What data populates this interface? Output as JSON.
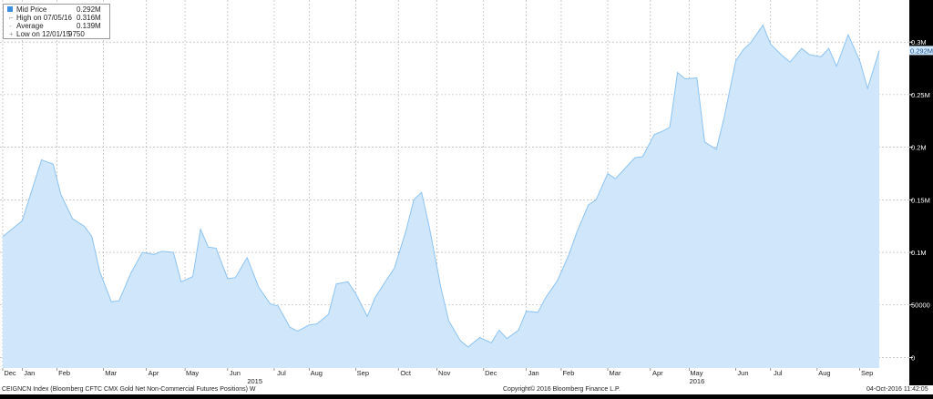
{
  "legend": {
    "items": [
      {
        "label": "Mid Price",
        "value": "0.292M"
      },
      {
        "label": "High on 07/05/16",
        "value": "0.316M"
      },
      {
        "label": "Average",
        "value": "0.139M"
      },
      {
        "label": "Low on 12/01/15",
        "value": "9750"
      }
    ]
  },
  "footer": {
    "ticker": "CEIGNCN Index (Bloomberg CFTC CMX Gold Net Non-Commercial Futures Positions)  W",
    "copyright": "Copyright© 2016 Bloomberg Finance L.P.",
    "timestamp": "04-Oct-2016 11:42:05"
  },
  "chart_data": {
    "type": "area",
    "title": "",
    "xlabel": "",
    "ylabel": "",
    "ylim": [
      -10000,
      340000
    ],
    "grid": true,
    "legend_position": "top-left",
    "colors": {
      "fill": "#cfe6fb",
      "line": "#8dc4f2",
      "background": "#ffffff",
      "grid": "#aaaaaa",
      "last_value_badge": "#cfe6fb"
    },
    "last_value_label": "0.292M",
    "y_ticks": [
      {
        "value": 300000,
        "label": "0.3M"
      },
      {
        "value": 250000,
        "label": "0.25M"
      },
      {
        "value": 200000,
        "label": "0.2M"
      },
      {
        "value": 150000,
        "label": "0.15M"
      },
      {
        "value": 100000,
        "label": "0.1M"
      },
      {
        "value": 50000,
        "label": "50000"
      },
      {
        "value": 0,
        "label": "0"
      }
    ],
    "x_months": [
      {
        "label": "Dec",
        "week": 0
      },
      {
        "label": "Jan",
        "week": 5
      },
      {
        "label": "Feb",
        "week": 14
      },
      {
        "label": "Mar",
        "week": 26
      },
      {
        "label": "Apr",
        "week": 37
      },
      {
        "label": "May",
        "week": 47
      },
      {
        "label": "Jun",
        "week": 58
      },
      {
        "label": "Jul",
        "week": 70
      },
      {
        "label": "Aug",
        "week": 79
      },
      {
        "label": "Sep",
        "week": 91
      },
      {
        "label": "Oct",
        "week": 102
      },
      {
        "label": "Nov",
        "week": 112
      },
      {
        "label": "Dec",
        "week": 124
      },
      {
        "label": "Jan",
        "week": 135
      },
      {
        "label": "Feb",
        "week": 144
      },
      {
        "label": "Mar",
        "week": 156
      },
      {
        "label": "Apr",
        "week": 167
      },
      {
        "label": "May",
        "week": 177
      },
      {
        "label": "Jun",
        "week": 189
      },
      {
        "label": "Jul",
        "week": 198
      },
      {
        "label": "Aug",
        "week": 210
      },
      {
        "label": "Sep",
        "week": 221
      }
    ],
    "x_years": [
      {
        "label": "2015",
        "week": 65
      },
      {
        "label": "2016",
        "week": 179
      }
    ],
    "x_weeks_total": 230,
    "series": [
      {
        "name": "Mid Price",
        "points": [
          [
            0,
            115000
          ],
          [
            5,
            130000
          ],
          [
            10,
            188000
          ],
          [
            13,
            184000
          ],
          [
            15,
            155000
          ],
          [
            18,
            132000
          ],
          [
            21,
            125000
          ],
          [
            23,
            115000
          ],
          [
            25,
            82000
          ],
          [
            28,
            53000
          ],
          [
            30,
            54000
          ],
          [
            33,
            80000
          ],
          [
            36,
            100000
          ],
          [
            39,
            98000
          ],
          [
            41,
            101000
          ],
          [
            44,
            100000
          ],
          [
            46,
            72000
          ],
          [
            49,
            77000
          ],
          [
            51,
            122000
          ],
          [
            53,
            105000
          ],
          [
            55,
            104000
          ],
          [
            58,
            75000
          ],
          [
            60,
            76000
          ],
          [
            63,
            95000
          ],
          [
            66,
            67000
          ],
          [
            69,
            51000
          ],
          [
            71,
            49000
          ],
          [
            74,
            29000
          ],
          [
            76,
            25000
          ],
          [
            79,
            31000
          ],
          [
            81,
            32000
          ],
          [
            84,
            41000
          ],
          [
            86,
            70000
          ],
          [
            89,
            72000
          ],
          [
            91,
            61000
          ],
          [
            94,
            39000
          ],
          [
            96,
            57000
          ],
          [
            99,
            74000
          ],
          [
            101,
            85000
          ],
          [
            104,
            121000
          ],
          [
            106,
            150000
          ],
          [
            108,
            157000
          ],
          [
            110,
            124000
          ],
          [
            113,
            66000
          ],
          [
            115,
            35000
          ],
          [
            118,
            16000
          ],
          [
            120,
            10000
          ],
          [
            123,
            19000
          ],
          [
            126,
            14000
          ],
          [
            128,
            26000
          ],
          [
            130,
            18000
          ],
          [
            133,
            26000
          ],
          [
            135,
            44000
          ],
          [
            138,
            43000
          ],
          [
            140,
            57000
          ],
          [
            143,
            73000
          ],
          [
            146,
            98000
          ],
          [
            148,
            119000
          ],
          [
            151,
            145000
          ],
          [
            153,
            150000
          ],
          [
            156,
            175000
          ],
          [
            158,
            170000
          ],
          [
            160,
            178000
          ],
          [
            163,
            190000
          ],
          [
            165,
            191000
          ],
          [
            168,
            212000
          ],
          [
            170,
            215000
          ],
          [
            172,
            219000
          ],
          [
            174,
            271000
          ],
          [
            176,
            265000
          ],
          [
            179,
            266000
          ],
          [
            181,
            205000
          ],
          [
            184,
            198000
          ],
          [
            186,
            228000
          ],
          [
            189,
            282000
          ],
          [
            191,
            293000
          ],
          [
            193,
            300000
          ],
          [
            196,
            316000
          ],
          [
            198,
            298000
          ],
          [
            201,
            287000
          ],
          [
            203,
            281000
          ],
          [
            206,
            294000
          ],
          [
            208,
            288000
          ],
          [
            211,
            286000
          ],
          [
            213,
            294000
          ],
          [
            215,
            277000
          ],
          [
            218,
            307000
          ],
          [
            221,
            282000
          ],
          [
            223,
            256000
          ],
          [
            226,
            292000
          ]
        ]
      }
    ]
  }
}
